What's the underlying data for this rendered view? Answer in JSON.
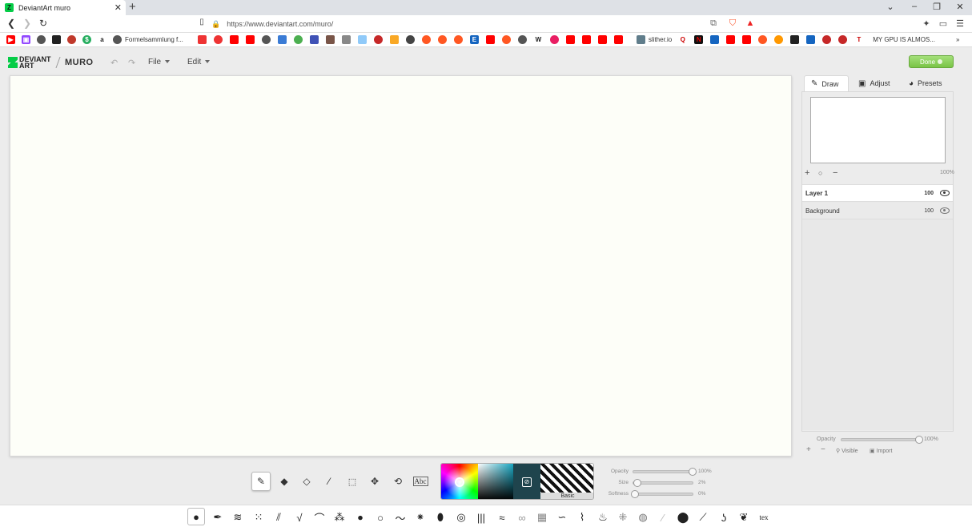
{
  "browser": {
    "tab_title": "DeviantArt muro",
    "url": "https://www.deviantart.com/muro/",
    "bookmarks": [
      {
        "icon": "youtube-icon",
        "label": "",
        "color": "#ff0000"
      },
      {
        "icon": "twitch-icon",
        "label": "",
        "color": "#9146ff"
      },
      {
        "icon": "globe-icon",
        "label": "",
        "color": "#444444"
      },
      {
        "icon": "app-icon",
        "label": "",
        "color": "#222222"
      },
      {
        "icon": "app-icon",
        "label": "",
        "color": "#c0392b"
      },
      {
        "icon": "app-icon",
        "label": "",
        "color": "#27ae60"
      },
      {
        "icon": "amazon-icon",
        "label": "",
        "color": "#222222"
      },
      {
        "icon": "globe-icon",
        "label": "Formelsammlung f...",
        "color": "#444444"
      }
    ],
    "bookmarks_overflow_label": "MY GPU IS ALMOS...",
    "slither_label": "slither.io"
  },
  "app": {
    "logo_text": "DEVIANT ART",
    "product": "MURO",
    "menus": [
      "File",
      "Edit"
    ],
    "done_label": "Done"
  },
  "panel": {
    "tabs": [
      "Draw",
      "Adjust",
      "Presets"
    ],
    "zoom": "100%",
    "layers": [
      {
        "name": "Layer 1",
        "opacity": "100"
      },
      {
        "name": "Background",
        "opacity": "100"
      }
    ],
    "opacity_label": "Opacity",
    "opacity_value": "100%",
    "visible_label": "Visible",
    "import_label": "Import"
  },
  "brush_settings": {
    "opacity_label": "Opacity",
    "opacity_value": "100%",
    "size_label": "Size",
    "size_value": "2%",
    "softness_label": "Softness",
    "softness_value": "0%",
    "texture_label": "Basic",
    "tool_text_label": "Abc"
  },
  "colors": {
    "accent": "#79c446",
    "current_color": "#1f444d"
  }
}
